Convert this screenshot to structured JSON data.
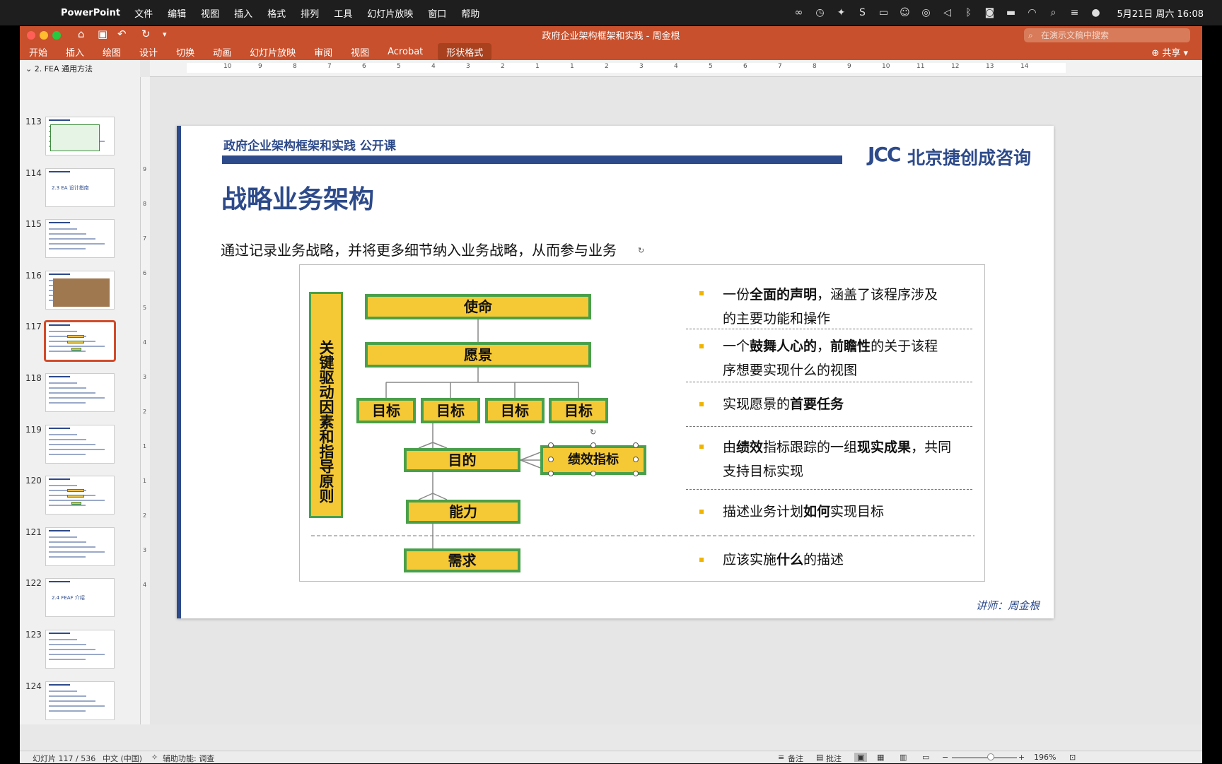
{
  "menubar": {
    "app": "PowerPoint",
    "menus": [
      "文件",
      "编辑",
      "视图",
      "插入",
      "格式",
      "排列",
      "工具",
      "幻灯片放映",
      "窗口",
      "帮助"
    ],
    "clock": "5月21日 周六 16:08"
  },
  "window": {
    "title": "政府企业架构框架和实践 - 周金根",
    "search_placeholder": "在演示文稿中搜索",
    "tabs": [
      "开始",
      "插入",
      "绘图",
      "设计",
      "切换",
      "动画",
      "幻灯片放映",
      "审阅",
      "视图",
      "Acrobat"
    ],
    "active_tab": "形状格式",
    "share_label": "共享",
    "section_label": "2. FEA 通用方法"
  },
  "thumbnails": [
    {
      "num": "113"
    },
    {
      "num": "114"
    },
    {
      "num": "115"
    },
    {
      "num": "116"
    },
    {
      "num": "117"
    },
    {
      "num": "118"
    },
    {
      "num": "119"
    },
    {
      "num": "120"
    },
    {
      "num": "121"
    },
    {
      "num": "122"
    },
    {
      "num": "123"
    },
    {
      "num": "124"
    }
  ],
  "thumb_texts": {
    "t114": "2.3 EA 设计指南",
    "t122": "2.4 FEAF 介绍"
  },
  "ruler": {
    "top_ticks": [
      "10",
      "9",
      "8",
      "7",
      "6",
      "5",
      "4",
      "3",
      "2",
      "1",
      "1",
      "2",
      "3",
      "4",
      "5",
      "6",
      "7",
      "8",
      "9",
      "10",
      "11",
      "12",
      "13",
      "14"
    ],
    "left_ticks": [
      "9",
      "8",
      "7",
      "6",
      "5",
      "4",
      "3",
      "2",
      "1",
      "1",
      "2",
      "3",
      "4"
    ]
  },
  "slide": {
    "course": "政府企业架构框架和实践 公开课",
    "logo": "JCC",
    "company": "北京捷创成咨询",
    "title": "战略业务架构",
    "subtitle": "通过记录业务战略，并将更多细节纳入业务战略，从而参与业务",
    "left_label": "关键驱动因素和指导原则",
    "boxes": {
      "mission": "使命",
      "vision": "愿景",
      "goal": "目标",
      "objective": "目的",
      "kpi": "绩效指标",
      "capability": "能力",
      "requirement": "需求"
    },
    "desc": {
      "d1": {
        "a": "一份",
        "b": "全面的声明",
        "c": "，涵盖了该程序涉及",
        "d": "的主要功能和操作"
      },
      "d2": {
        "a": "一个",
        "b": "鼓舞人心的",
        "c": "，",
        "d": "前瞻性",
        "e": "的关于该程",
        "f": "序想要实现什么的视图"
      },
      "d3": {
        "a": "实现愿景的",
        "b": "首要任务"
      },
      "d4": {
        "a": "由",
        "b": "绩效",
        "c": "指标跟踪的一组",
        "d": "现实成果",
        "e": "，共同",
        "f": "支持目标实现"
      },
      "d5": {
        "a": "描述业务计划",
        "b": "如何",
        "c": "实现目标"
      },
      "d6": {
        "a": "应该实施",
        "b": "什么",
        "c": "的描述"
      }
    },
    "lecturer": "讲师：周金根"
  },
  "status": {
    "slide_pos": "幻灯片 117 / 536",
    "language": "中文 (中国)",
    "accessibility": "辅助功能: 调查",
    "notes": "备注",
    "comments": "批注",
    "zoom": "196%"
  },
  "colors": {
    "titlebar": "#c8502c",
    "slide_blue": "#2d4a8a",
    "box_fill": "#f5c935",
    "box_border": "#4aa04a"
  }
}
